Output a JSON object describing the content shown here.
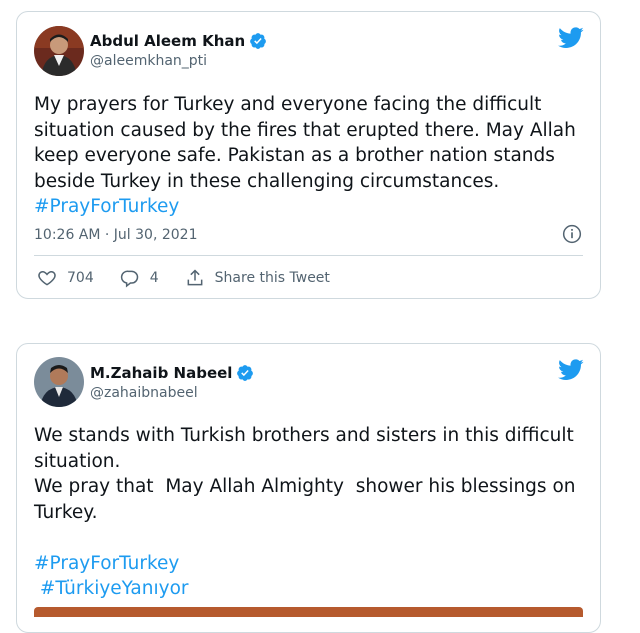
{
  "tweets": [
    {
      "name": "Abdul Aleem Khan",
      "handle": "@aleemkhan_pti",
      "text": "My prayers for Turkey and everyone facing the difficult situation caused by the fires that erupted there. May Allah keep everyone safe. Pakistan as a brother nation stands beside Turkey in these challenging circumstances.",
      "hashtags": [
        "#PrayForTurkey"
      ],
      "timestamp": "10:26 AM · Jul 30, 2021",
      "likes": "704",
      "replies": "4",
      "share_label": "Share this Tweet"
    },
    {
      "name": "M.Zahaib Nabeel",
      "handle": "@zahaibnabeel",
      "text": "We stands with Turkish brothers and sisters in this difficult situation.\nWe pray that  May Allah Almighty  shower his blessings on Turkey.",
      "hashtags": [
        "#PrayForTurkey",
        "#TürkiyeYanıyor"
      ]
    }
  ],
  "colors": {
    "accent": "#1d9bf0",
    "text": "#0f1419",
    "muted": "#536471",
    "border": "#cfd9de"
  },
  "icons": [
    "verified-badge-icon",
    "twitter-bird-icon",
    "info-icon",
    "heart-icon",
    "reply-icon",
    "share-icon"
  ]
}
